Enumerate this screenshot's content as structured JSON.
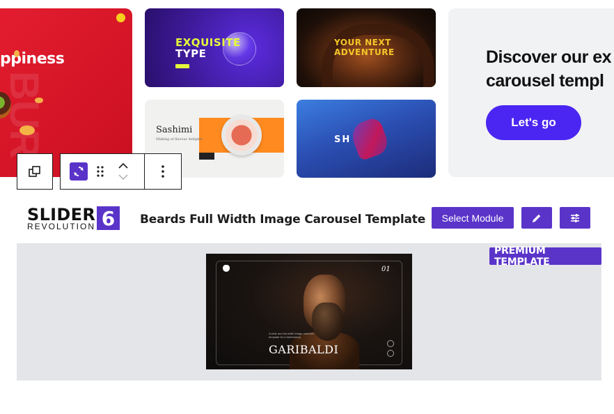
{
  "gallery": {
    "card_red": {
      "headline": "ppiness",
      "ghost_text": "BUR"
    },
    "card_purple": {
      "line1": "EXQUISITE",
      "line2": "TYPE"
    },
    "card_cave": {
      "line1": "YOUR NEXT",
      "line2": "ADVENTURE"
    },
    "card_sashimi": {
      "title": "Sashimi",
      "subtitle": "Making of flavour delights"
    },
    "card_shoe": {
      "text": "SH  IDO"
    }
  },
  "discover": {
    "line1": "Discover our ex",
    "line2": "carousel templ",
    "cta_label": "Let's go"
  },
  "block_toolbar": {
    "icons": [
      "duplicate-icon",
      "slider-revolution-block-icon",
      "drag-handle-icon",
      "chevron-up-icon",
      "chevron-down-icon",
      "more-options-icon"
    ]
  },
  "module_header": {
    "logo_word": "SLIDER",
    "logo_sub": "REVOLUTION",
    "logo_number": "6",
    "template_title": "Beards Full Width Image Carousel Template",
    "select_module_label": "Select Module",
    "edit_icon": "pencil-icon",
    "settings_icon": "sliders-icon"
  },
  "preview": {
    "badge": "PREMIUM TEMPLATE",
    "slide_number": "01",
    "slide_title": "GARIBALDI",
    "caption": "A wide and full-width image carousel template for a barbershop."
  },
  "colors": {
    "accent": "#5a34c9",
    "cta": "#4b26f2",
    "preview_bg": "#e4e5e9"
  }
}
